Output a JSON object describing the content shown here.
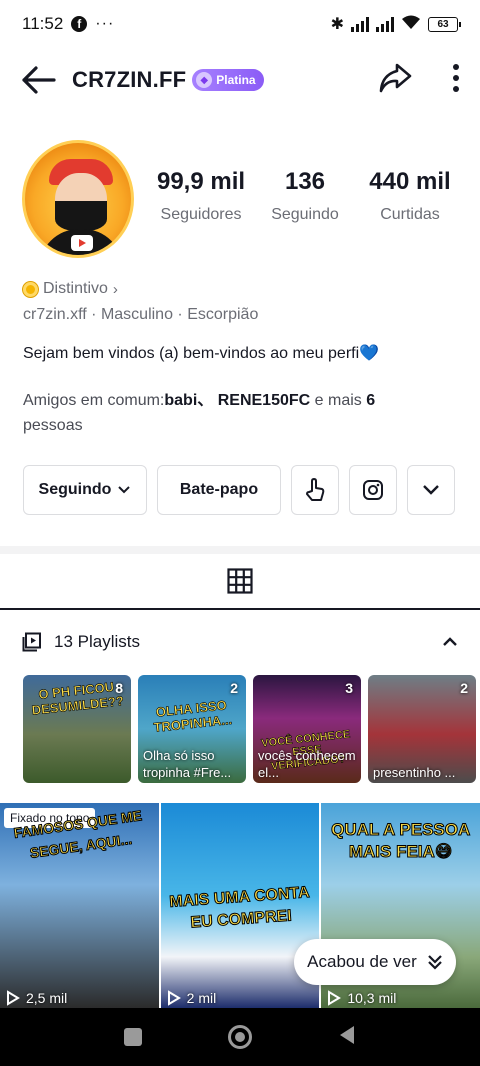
{
  "status": {
    "time": "11:52",
    "battery": "63"
  },
  "header": {
    "username": "CR7ZIN.FF",
    "badge": "Platina"
  },
  "stats": [
    {
      "value": "99,9 mil",
      "label": "Seguidores"
    },
    {
      "value": "136",
      "label": "Seguindo"
    },
    {
      "value": "440 mil",
      "label": "Curtidas"
    }
  ],
  "profile": {
    "distintivo": "Distintivo",
    "meta": "cr7zin.xff · Masculino · Escorpião",
    "bio": "Sejam bem vindos (a) bem-vindos ao meu perfi💙",
    "friends_prefix": "Amigos em comum:",
    "friends_names": "babi、 RENE150FC",
    "friends_mid": " e mais ",
    "friends_count": "6",
    "friends_suffix": "pessoas"
  },
  "actions": {
    "following": "Seguindo",
    "chat": "Bate-papo"
  },
  "playlists": {
    "header": "13 Playlists",
    "items": [
      {
        "count": "8",
        "title": "O PH FICOU DESUMILDE??",
        "caption": ""
      },
      {
        "count": "2",
        "title": "OLHA ISSO TROPINHA...",
        "caption": "Olha só isso tropinha #Fre..."
      },
      {
        "count": "3",
        "title": "VOCÊ CONHECE ESSE VERIFICADO?",
        "caption": "vocês conhecem el..."
      },
      {
        "count": "2",
        "title": "",
        "caption": "presentinho ..."
      }
    ]
  },
  "videos": [
    {
      "pinned": "Fixado no topo",
      "title": "FAMOSOS QUE ME SEGUE, AQUI...",
      "views": "2,5 mil"
    },
    {
      "pinned": "",
      "title": "MAIS UMA CONTA EU COMPREI",
      "views": "2 mil"
    },
    {
      "pinned": "",
      "title": "QUAL A PESSOA MAIS FEIA😅",
      "views": "10,3 mil"
    }
  ],
  "watched_pill": "Acabou de ver",
  "colors": {
    "badge": "#8b5cf6",
    "text": "#161823",
    "muted": "#6b6d75"
  }
}
